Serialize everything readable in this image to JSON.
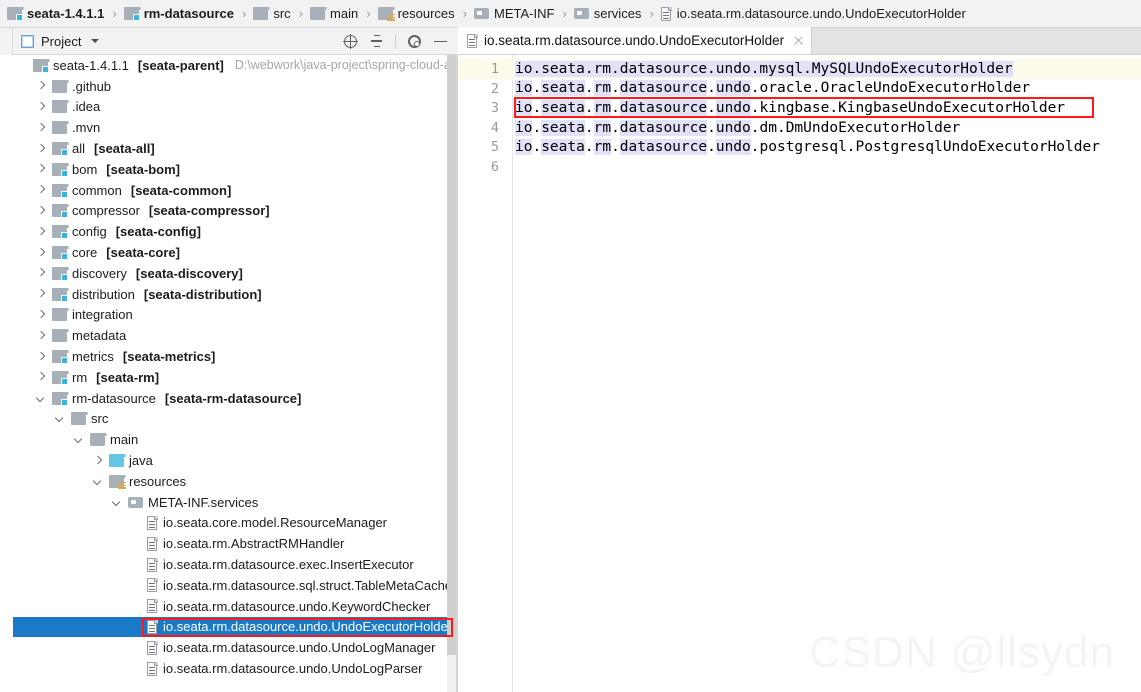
{
  "breadcrumb": {
    "items": [
      {
        "label": "seata-1.4.1.1",
        "icon": "module-folder-icon",
        "bold": true
      },
      {
        "label": "rm-datasource",
        "icon": "module-folder-icon",
        "bold": true
      },
      {
        "label": "src",
        "icon": "folder-icon",
        "bold": false
      },
      {
        "label": "main",
        "icon": "folder-icon",
        "bold": false
      },
      {
        "label": "resources",
        "icon": "resources-folder-icon",
        "bold": false
      },
      {
        "label": "META-INF",
        "icon": "package-folder-icon",
        "bold": false
      },
      {
        "label": "services",
        "icon": "package-folder-icon",
        "bold": false
      },
      {
        "label": "io.seata.rm.datasource.undo.UndoExecutorHolder",
        "icon": "file-icon",
        "bold": false
      }
    ],
    "separator": "›"
  },
  "tool_window": {
    "title": "Project",
    "dropdown_caret": "▾",
    "actions": [
      {
        "name": "locate-in-tree",
        "icon": "target-icon"
      },
      {
        "name": "collapse-all",
        "icon": "collapse-all-icon"
      },
      {
        "name": "settings",
        "icon": "gear-icon"
      },
      {
        "name": "hide",
        "icon": "minus-icon"
      }
    ]
  },
  "editor_tabs": [
    {
      "label": "io.seata.rm.datasource.undo.UndoExecutorHolder",
      "icon": "file-icon",
      "active": true,
      "close": "×"
    }
  ],
  "tree": {
    "rows": [
      {
        "indent": 0,
        "chev": "none",
        "icon": "module-folder-icon",
        "label": "seata-1.4.1.1",
        "bold_suffix": "[seata-parent]",
        "path": "D:\\webwork\\java-project\\spring-cloud-aliba"
      },
      {
        "indent": 1,
        "chev": "right",
        "icon": "folder-icon",
        "label": ".github"
      },
      {
        "indent": 1,
        "chev": "right",
        "icon": "folder-icon",
        "label": ".idea"
      },
      {
        "indent": 1,
        "chev": "right",
        "icon": "folder-icon",
        "label": ".mvn"
      },
      {
        "indent": 1,
        "chev": "right",
        "icon": "module-folder-icon",
        "label": "all",
        "bold_suffix": "[seata-all]"
      },
      {
        "indent": 1,
        "chev": "right",
        "icon": "module-folder-icon",
        "label": "bom",
        "bold_suffix": "[seata-bom]"
      },
      {
        "indent": 1,
        "chev": "right",
        "icon": "module-folder-icon",
        "label": "common",
        "bold_suffix": "[seata-common]"
      },
      {
        "indent": 1,
        "chev": "right",
        "icon": "module-folder-icon",
        "label": "compressor",
        "bold_suffix": "[seata-compressor]"
      },
      {
        "indent": 1,
        "chev": "right",
        "icon": "module-folder-icon",
        "label": "config",
        "bold_suffix": "[seata-config]"
      },
      {
        "indent": 1,
        "chev": "right",
        "icon": "module-folder-icon",
        "label": "core",
        "bold_suffix": "[seata-core]"
      },
      {
        "indent": 1,
        "chev": "right",
        "icon": "module-folder-icon",
        "label": "discovery",
        "bold_suffix": "[seata-discovery]"
      },
      {
        "indent": 1,
        "chev": "right",
        "icon": "module-folder-icon",
        "label": "distribution",
        "bold_suffix": "[seata-distribution]"
      },
      {
        "indent": 1,
        "chev": "right",
        "icon": "folder-icon",
        "label": "integration"
      },
      {
        "indent": 1,
        "chev": "right",
        "icon": "folder-icon",
        "label": "metadata"
      },
      {
        "indent": 1,
        "chev": "right",
        "icon": "module-folder-icon",
        "label": "metrics",
        "bold_suffix": "[seata-metrics]"
      },
      {
        "indent": 1,
        "chev": "right",
        "icon": "module-folder-icon",
        "label": "rm",
        "bold_suffix": "[seata-rm]"
      },
      {
        "indent": 1,
        "chev": "down",
        "icon": "module-folder-icon",
        "label": "rm-datasource",
        "bold_suffix": "[seata-rm-datasource]"
      },
      {
        "indent": 2,
        "chev": "down",
        "icon": "folder-icon",
        "label": "src"
      },
      {
        "indent": 3,
        "chev": "down",
        "icon": "folder-icon",
        "label": "main"
      },
      {
        "indent": 4,
        "chev": "right",
        "icon": "source-folder-icon",
        "label": "java"
      },
      {
        "indent": 4,
        "chev": "down",
        "icon": "resources-folder-icon",
        "label": "resources"
      },
      {
        "indent": 5,
        "chev": "down",
        "icon": "package-folder-icon",
        "label": "META-INF.services"
      },
      {
        "indent": 6,
        "chev": "none",
        "icon": "file-icon",
        "label": "io.seata.core.model.ResourceManager"
      },
      {
        "indent": 6,
        "chev": "none",
        "icon": "file-icon",
        "label": "io.seata.rm.AbstractRMHandler"
      },
      {
        "indent": 6,
        "chev": "none",
        "icon": "file-icon",
        "label": "io.seata.rm.datasource.exec.InsertExecutor"
      },
      {
        "indent": 6,
        "chev": "none",
        "icon": "file-icon",
        "label": "io.seata.rm.datasource.sql.struct.TableMetaCache"
      },
      {
        "indent": 6,
        "chev": "none",
        "icon": "file-icon",
        "label": "io.seata.rm.datasource.undo.KeywordChecker"
      },
      {
        "indent": 6,
        "chev": "none",
        "icon": "file-icon",
        "label": "io.seata.rm.datasource.undo.UndoExecutorHolder",
        "selected": true,
        "annotated": true
      },
      {
        "indent": 6,
        "chev": "none",
        "icon": "file-icon",
        "label": "io.seata.rm.datasource.undo.UndoLogManager"
      },
      {
        "indent": 6,
        "chev": "none",
        "icon": "file-icon",
        "label": "io.seata.rm.datasource.undo.UndoLogParser"
      }
    ]
  },
  "editor": {
    "line_numbers": [
      "1",
      "2",
      "3",
      "4",
      "5",
      "6"
    ],
    "caret_line": 1,
    "annotated_line": 3,
    "lines": [
      {
        "n": 1,
        "prefix": "io.seata.rm.datasource.undo.",
        "suffix": "mysql.MySQLUndoExecutorHolder",
        "full_highlight": true
      },
      {
        "n": 2,
        "prefix": "io.seata.rm.datasource.undo.",
        "suffix": "oracle.OracleUndoExecutorHolder",
        "full_highlight": false
      },
      {
        "n": 3,
        "prefix": "io.seata.rm.datasource.undo.",
        "suffix": "kingbase.KingbaseUndoExecutorHolder",
        "full_highlight": false
      },
      {
        "n": 4,
        "prefix": "io.seata.rm.datasource.undo.",
        "suffix": "dm.DmUndoExecutorHolder",
        "full_highlight": false
      },
      {
        "n": 5,
        "prefix": "io.seata.rm.datasource.undo.",
        "suffix": "postgresql.PostgresqlUndoExecutorHolder",
        "full_highlight": false
      },
      {
        "n": 6,
        "prefix": "",
        "suffix": "",
        "full_highlight": false
      }
    ]
  },
  "watermark": "CSDN @llsydn",
  "colors": {
    "selection_blue": "#1a7ac7",
    "annotation_red": "#ff1a1a",
    "caret_line_yellow": "#fcfae8",
    "identifier_highlight": "#e2e1f7",
    "panel_bg": "#f2f2f2"
  }
}
